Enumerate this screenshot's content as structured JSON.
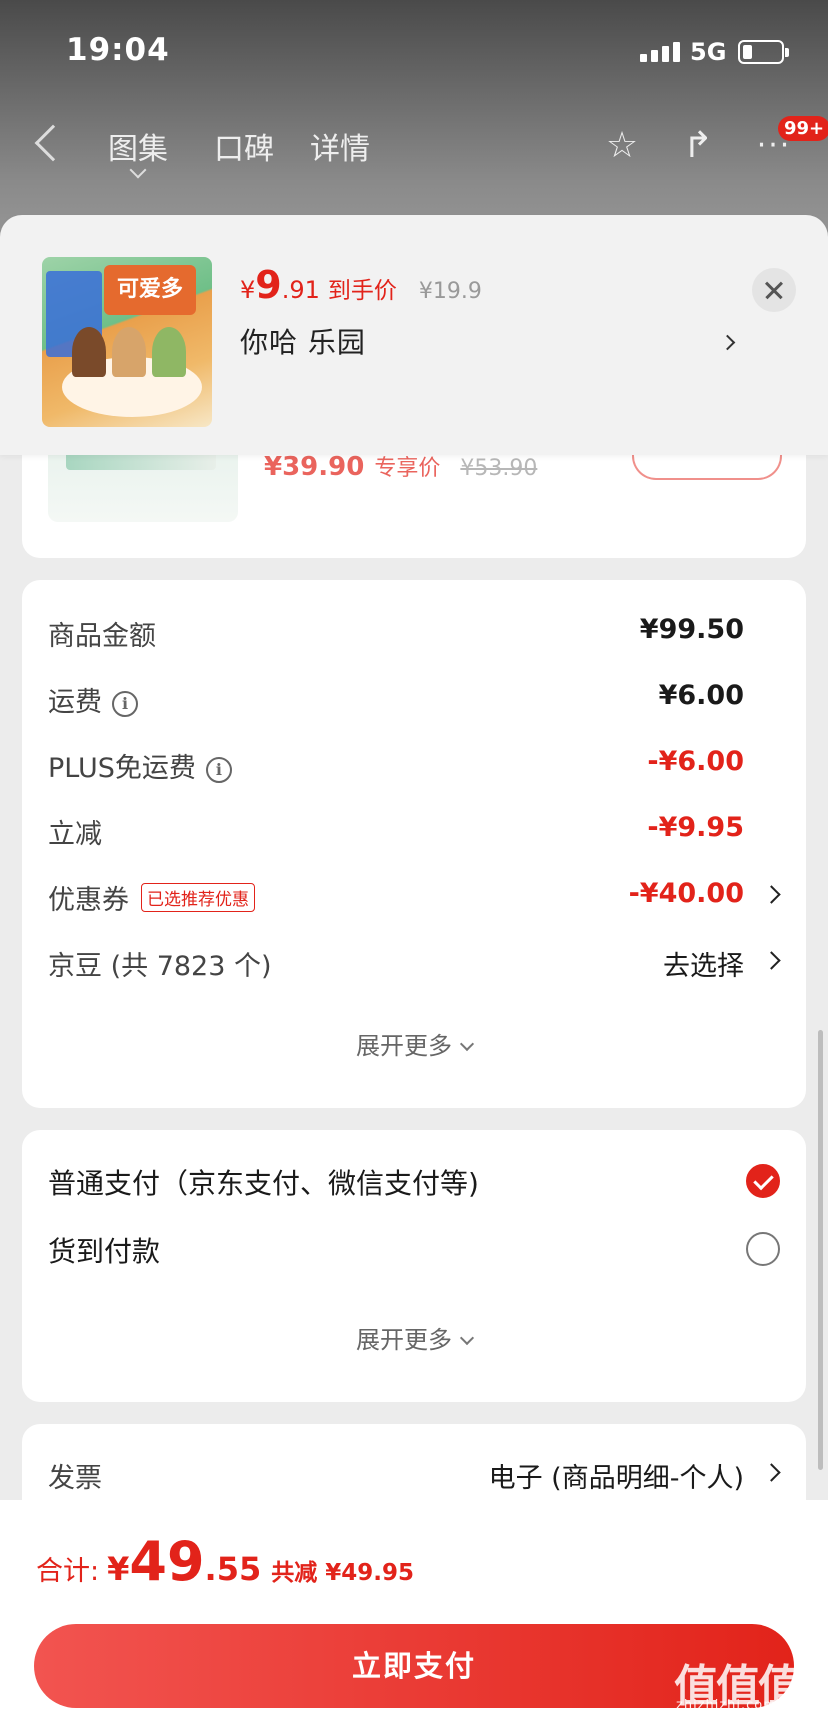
{
  "status_bar": {
    "time": "19:04",
    "network": "5G"
  },
  "nav": {
    "tabs": [
      "图集",
      "口碑",
      "详情"
    ],
    "badge": "99+"
  },
  "sheet": {
    "price_yen": "¥",
    "price_int": "9",
    "price_dec": ".91",
    "price_tag": "到手价",
    "original_price": "¥19.9",
    "shop_name": "你哈  乐园",
    "image_logo_text": "可爱多"
  },
  "recommend": {
    "price": "¥39.90",
    "price_tag": "专享价",
    "old_price": "¥53.90"
  },
  "price_detail": {
    "rows": [
      {
        "label": "商品金额",
        "value": "¥99.50"
      },
      {
        "label": "运费",
        "value": "¥6.00"
      },
      {
        "label": "PLUS免运费",
        "value": "-¥6.00"
      },
      {
        "label": "立减",
        "value": "-¥9.95"
      },
      {
        "label": "优惠券",
        "tag": "已选推荐优惠",
        "value": "-¥40.00"
      },
      {
        "label": "京豆 (共 7823 个)",
        "value": "去选择"
      }
    ],
    "expand_label": "展开更多"
  },
  "payment": {
    "options": [
      {
        "label": "普通支付（京东支付、微信支付等)",
        "selected": true
      },
      {
        "label": "货到付款",
        "selected": false
      }
    ],
    "expand_label": "展开更多"
  },
  "invoice": {
    "label": "发票",
    "value": "电子 (商品明细-个人)"
  },
  "bottom": {
    "total_label": "合计:",
    "total_yen": "¥",
    "total_int": "49",
    "total_dec": ".55",
    "saved": "共减 ¥49.95",
    "pay_button": "立即支付",
    "watermark": "值值值",
    "watermark_sub": "zhizhizhi.com"
  },
  "colors": {
    "accent": "#e2231a"
  }
}
